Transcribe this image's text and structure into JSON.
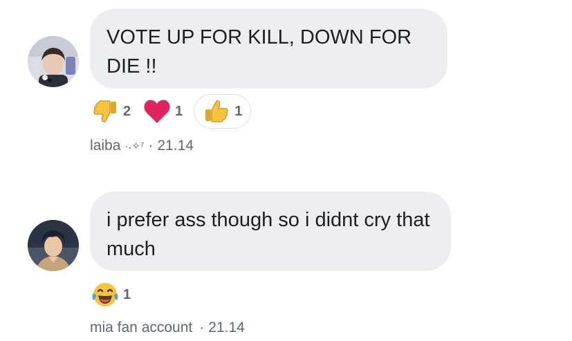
{
  "comments": [
    {
      "text": "VOTE UP FOR KILL, DOWN FOR DIE !!",
      "author": "laiba",
      "author_decoration": "·˖✧⁷",
      "separator": "·",
      "time": "21.14",
      "avatar_icon": "photo-avatar-icon",
      "reactions": [
        {
          "icon": "thumbs-down-icon",
          "count": "2"
        },
        {
          "icon": "heart-icon",
          "count": "1"
        },
        {
          "icon": "thumbs-up-icon",
          "count": "1",
          "selected": true
        }
      ]
    },
    {
      "text": "i prefer ass though so i didnt cry that much",
      "author": "mia fan account",
      "separator": "·",
      "time": "21.14",
      "avatar_icon": "anime-avatar-icon",
      "reactions": [
        {
          "icon": "laughing-crying-icon",
          "count": "1"
        }
      ]
    }
  ],
  "colors": {
    "bubble": "#eceef1",
    "text": "#1c1e21",
    "meta": "#606770",
    "heart": "#e0245e",
    "emoji_yellow": "#f7c440"
  }
}
